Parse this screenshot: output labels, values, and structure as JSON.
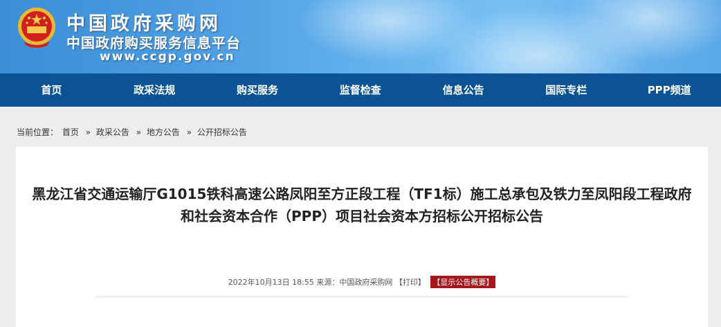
{
  "header": {
    "site_title": "中国政府采购网",
    "site_subtitle": "中国政府购买服务信息平台",
    "site_url": "www.ccgp.gov.cn",
    "emblem_icon": "national-emblem-icon",
    "colors": {
      "banner": "#4a9be0",
      "nav": "#0b5394",
      "accent": "#a6171c"
    }
  },
  "nav": {
    "items": [
      {
        "label": "首页"
      },
      {
        "label": "政采法规"
      },
      {
        "label": "购买服务"
      },
      {
        "label": "监督检查"
      },
      {
        "label": "信息公告"
      },
      {
        "label": "国际专栏"
      },
      {
        "label": "PPP频道"
      }
    ]
  },
  "breadcrumb": {
    "prefix": "当前位置：",
    "items": [
      "首页",
      "政采公告",
      "地方公告",
      "公开招标公告"
    ],
    "separator": "»"
  },
  "article": {
    "title": "黑龙江省交通运输厅G1015铁科高速公路凤阳至方正段工程（TF1标）施工总承包及铁力至凤阳段工程政府和社会资本合作（PPP）项目社会资本方招标公开招标公告",
    "meta": {
      "date": "2022年10月13日 18:55",
      "source_label": "来源：",
      "source": "中国政府采购网",
      "print_label": "【打印】",
      "summary_label": "【显示公告概要】"
    }
  }
}
